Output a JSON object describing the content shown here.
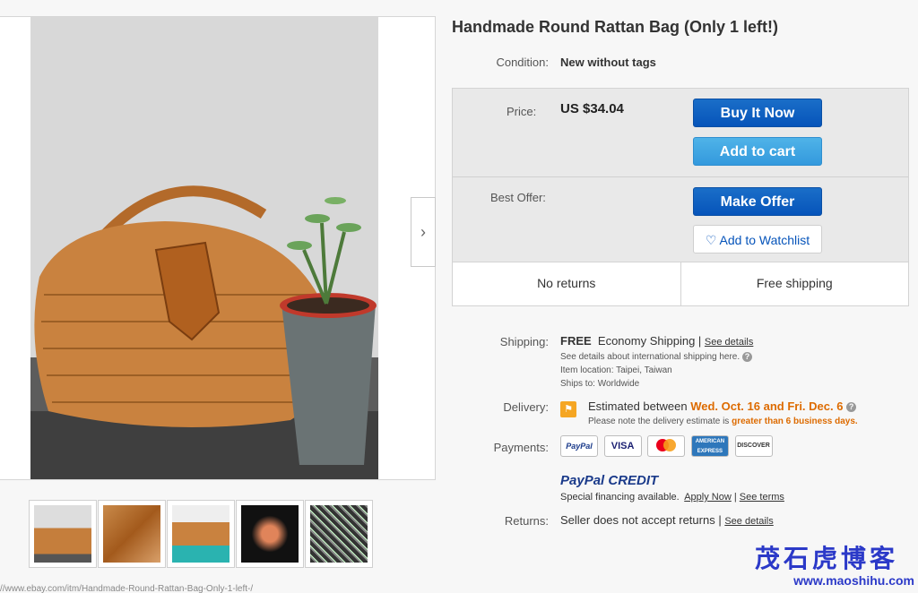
{
  "item": {
    "title": "Handmade Round Rattan Bag (Only 1 left!)",
    "condition_label": "Condition:",
    "condition_value": "New without tags"
  },
  "buy_box": {
    "price_label": "Price:",
    "price_value": "US $34.04",
    "buy_now_label": "Buy It Now",
    "add_to_cart_label": "Add to cart",
    "best_offer_label": "Best Offer:",
    "make_offer_label": "Make Offer",
    "watchlist_label": "Add to Watchlist",
    "returns_summary": "No returns",
    "shipping_summary": "Free shipping"
  },
  "shipping": {
    "label": "Shipping:",
    "free": "FREE",
    "method": "Economy Shipping",
    "see_details": "See details",
    "intl_note": "See details about international shipping here.",
    "item_location": "Item location:  Taipei, Taiwan",
    "ships_to": "Ships to:  Worldwide"
  },
  "delivery": {
    "label": "Delivery:",
    "estimated_prefix": "Estimated between",
    "date_range": "Wed. Oct. 16 and Fri. Dec. 6",
    "note_prefix": "Please note the delivery estimate is",
    "note_highlight": "greater than 6 business days."
  },
  "payments": {
    "label": "Payments:",
    "logos": [
      "PayPal",
      "VISA",
      "MasterCard",
      "AMERICAN EXPRESS",
      "DISCOVER"
    ],
    "credit_brand": "PayPal CREDIT",
    "financing_text": "Special financing available.",
    "apply_now": "Apply Now",
    "see_terms": "See terms"
  },
  "returns": {
    "label": "Returns:",
    "text": "Seller does not accept returns |",
    "see_details": "See details"
  },
  "watermark": {
    "chinese": "茂石虎博客",
    "url": "www.maoshihu.com"
  },
  "url_bar_fragment": "//www.ebay.com/itm/Handmade-Round-Rattan-Bag-Only-1-left-/"
}
